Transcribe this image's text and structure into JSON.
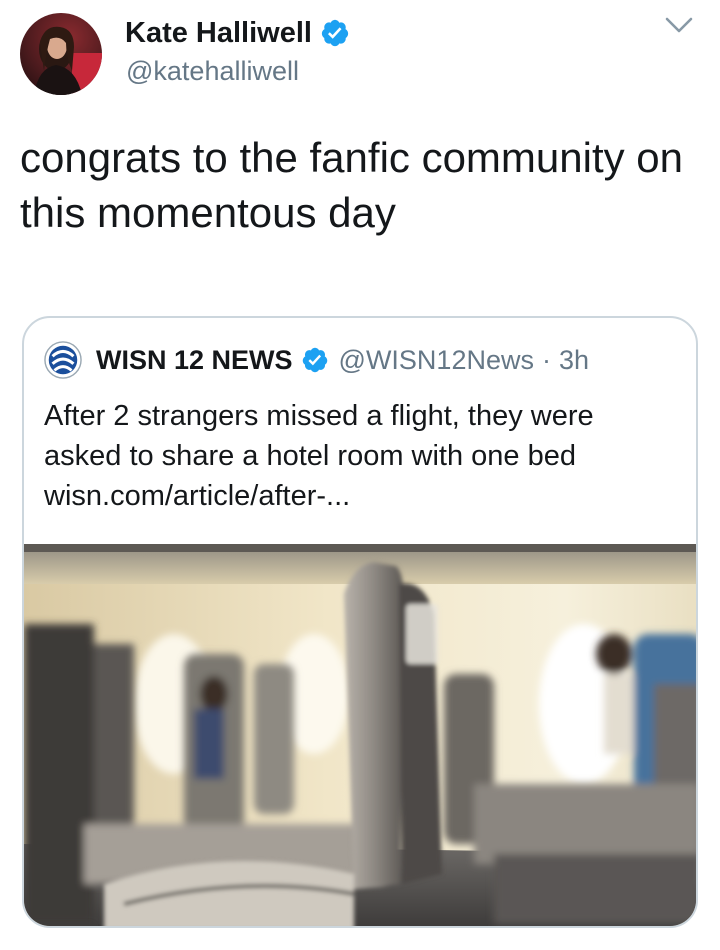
{
  "tweet": {
    "author": {
      "display_name": "Kate Halliwell",
      "handle": "@katehalliwell",
      "verified": true,
      "avatar_icon": "profile-photo"
    },
    "text": "congrats to the fanfic community on this momentous day",
    "menu_icon": "chevron-down-icon"
  },
  "quoted_tweet": {
    "author": {
      "display_name": "WISN 12 NEWS",
      "handle": "@WISN12News",
      "verified": true,
      "logo_icon": "wisn-logo"
    },
    "separator": "·",
    "time": "3h",
    "text_line1": "After 2 strangers missed a flight, they were",
    "text_line2": "asked to share a hotel room with one bed",
    "link": "wisn.com/article/after-...",
    "image_icon": "airplane-cabin-seats-photo"
  },
  "colors": {
    "text_primary": "#14171a",
    "text_secondary": "#657786",
    "verified_blue": "#1da1f2",
    "card_border": "#ccd6dd"
  }
}
